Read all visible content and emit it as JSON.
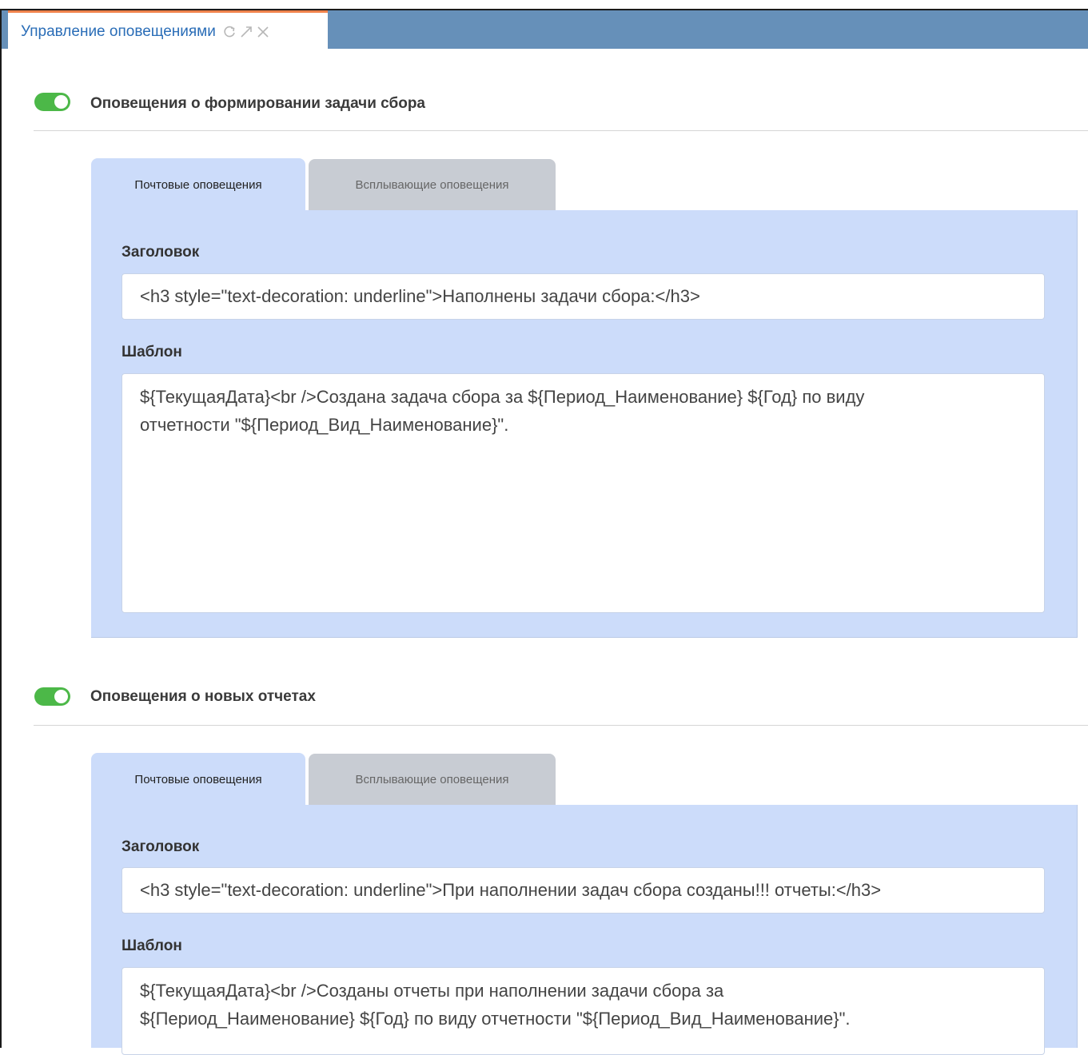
{
  "window_tab": {
    "title": "Управление оповещениями",
    "icons": [
      "refresh-icon",
      "expand-icon",
      "close-icon"
    ]
  },
  "sections": [
    {
      "enabled": true,
      "title": "Оповещения о формировании задачи сбора",
      "tabs": [
        "Почтовые оповещения",
        "Всплывающие оповещения"
      ],
      "active_tab": 0,
      "header_label": "Заголовок",
      "header_value": "<h3 style=\"text-decoration: underline\">Наполнены задачи сбора:</h3>",
      "template_label": "Шаблон",
      "template_value": "${ТекущаяДата}<br />Создана задача сбора за ${Период_Наименование} ${Год} по виду\nотчетности \"${Период_Вид_Наименование}\"."
    },
    {
      "enabled": true,
      "title": "Оповещения о новых отчетах",
      "tabs": [
        "Почтовые оповещения",
        "Всплывающие оповещения"
      ],
      "active_tab": 0,
      "header_label": "Заголовок",
      "header_value": "<h3 style=\"text-decoration: underline\">При наполнении задач сбора созданы!!! отчеты:</h3>",
      "template_label": "Шаблон",
      "template_value": "${ТекущаяДата}<br />Созданы отчеты при наполнении задачи сбора за\n${Период_Наименование} ${Год} по виду отчетности \"${Период_Вид_Наименование}\"."
    }
  ],
  "colors": {
    "tabbar": "#6690b9",
    "tab_accent": "#f0834c",
    "toggle_on": "#4cb848",
    "panel_bg": "#ccdcfa",
    "inactive_tab_bg": "#c8ccd3"
  }
}
